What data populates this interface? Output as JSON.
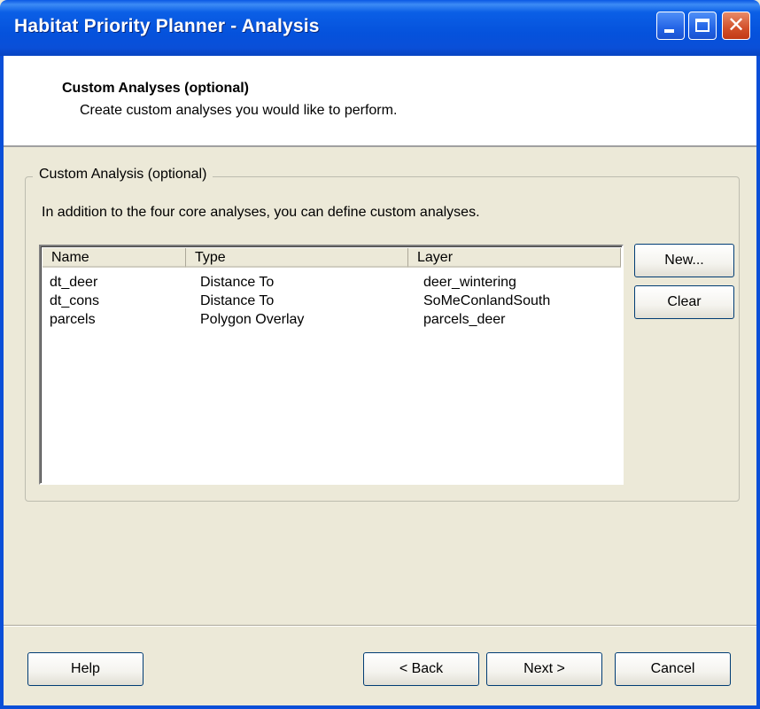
{
  "window": {
    "title": "Habitat Priority Planner - Analysis",
    "controls": {
      "minimize_icon": "minimize-icon",
      "maximize_icon": "maximize-icon",
      "close_icon": "close-icon",
      "close_glyph": "✕"
    }
  },
  "header": {
    "title": "Custom Analyses (optional)",
    "subtitle": "Create custom analyses you would like to perform."
  },
  "group": {
    "legend": "Custom Analysis (optional)",
    "description": "In addition to the four core analyses, you can define custom analyses."
  },
  "list": {
    "columns": [
      "Name",
      "Type",
      "Layer"
    ],
    "rows": [
      {
        "name": "dt_deer",
        "type": "Distance To",
        "layer": "deer_wintering"
      },
      {
        "name": "dt_cons",
        "type": "Distance To",
        "layer": "SoMeConlandSouth"
      },
      {
        "name": "parcels",
        "type": "Polygon Overlay",
        "layer": "parcels_deer"
      }
    ]
  },
  "side_buttons": {
    "new": "New...",
    "clear": "Clear"
  },
  "footer": {
    "help": "Help",
    "back": "< Back",
    "next": "Next >",
    "cancel": "Cancel"
  },
  "colors": {
    "titlebar": "#0a4fd8",
    "dialog_bg": "#ece9d8",
    "close_button": "#d2502a"
  }
}
